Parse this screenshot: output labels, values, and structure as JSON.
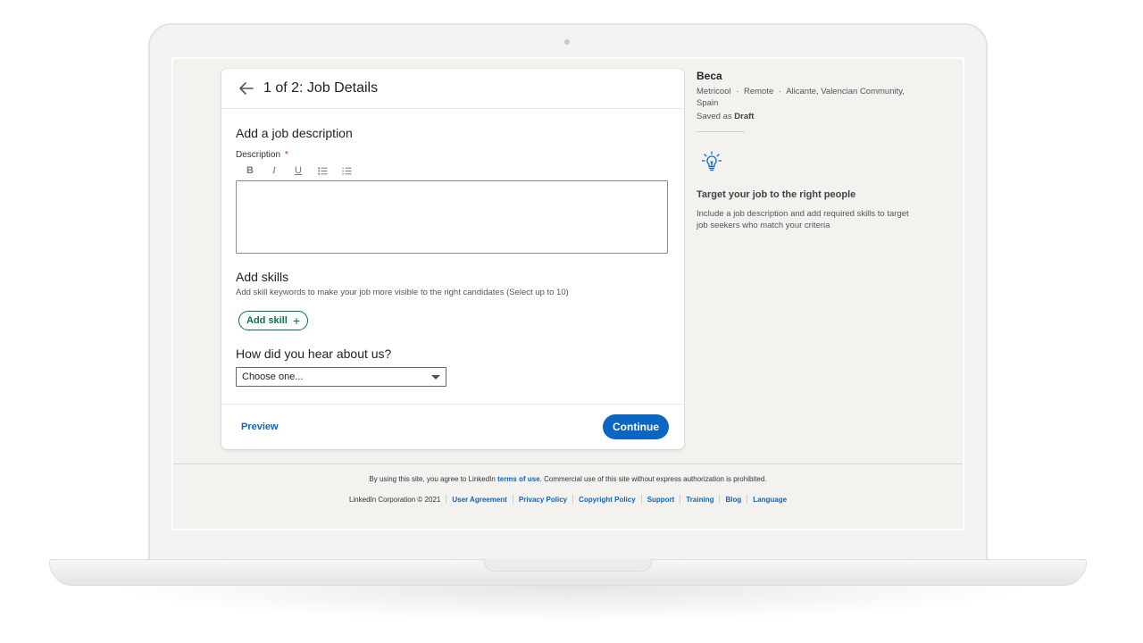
{
  "header": {
    "title": "1 of 2: Job Details"
  },
  "description_section": {
    "title": "Add a job description",
    "field_label": "Description",
    "required_mark": "*",
    "toolbar": {
      "bold": "B",
      "italic": "I",
      "underline": "U"
    },
    "value": ""
  },
  "skills_section": {
    "title": "Add skills",
    "subtitle": "Add skill keywords to make your job more visible to the right candidates (Select up to 10)",
    "add_label": "Add skill",
    "add_icon": "+"
  },
  "hear_section": {
    "title": "How did you hear about us?",
    "selected": "Choose one..."
  },
  "footer_actions": {
    "preview": "Preview",
    "continue": "Continue"
  },
  "job_summary": {
    "name": "Beca",
    "company": "Metricool",
    "workplace": "Remote",
    "location_line1": "Alicante, Valencian Community,",
    "location_line2": "Spain",
    "saved_prefix": "Saved as",
    "saved_state": "Draft",
    "bullet": "·"
  },
  "tip": {
    "icon": "lightbulb-icon",
    "title": "Target your job to the right people",
    "text": "Include a job description and add required skills to target job seekers who match your criteria"
  },
  "page_footer": {
    "legal_before": "By using this site, you agree to LinkedIn",
    "legal_link": "terms of use",
    "legal_after": ". Commercial use of this site without express authorization is prohibited.",
    "copyright": "LinkedIn Corporation © 2021",
    "links": [
      "User Agreement",
      "Privacy Policy",
      "Copyright Policy",
      "Support",
      "Training",
      "Blog",
      "Language"
    ]
  },
  "colors": {
    "brand_blue": "#0a66c2",
    "skill_green": "#057642",
    "page_bg": "#f3f2ef",
    "required_red": "#c3262f"
  }
}
